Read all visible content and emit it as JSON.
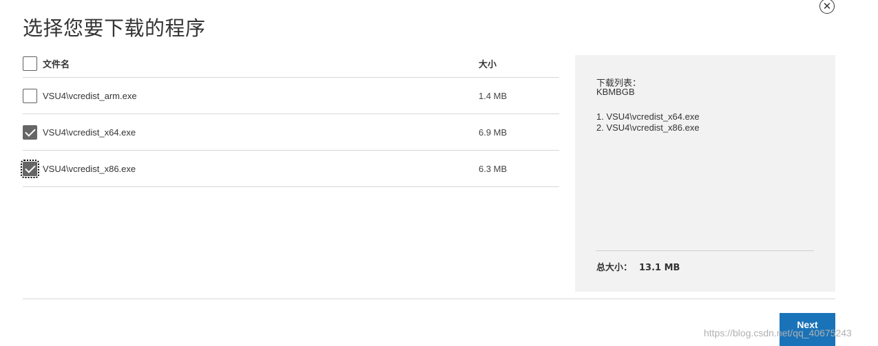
{
  "dialog": {
    "title": "选择您要下载的程序",
    "close_icon": "✕"
  },
  "table": {
    "headers": {
      "name": "文件名",
      "size": "大小"
    },
    "select_all_checked": false,
    "rows": [
      {
        "name": "VSU4\\vcredist_arm.exe",
        "size": "1.4 MB",
        "checked": false
      },
      {
        "name": "VSU4\\vcredist_x64.exe",
        "size": "6.9 MB",
        "checked": true
      },
      {
        "name": "VSU4\\vcredist_x86.exe",
        "size": "6.3 MB",
        "checked": true,
        "focused": true
      }
    ]
  },
  "panel": {
    "title": "下载列表：",
    "package_name": "KBMBGB",
    "items": [
      "1. VSU4\\vcredist_x64.exe",
      "2. VSU4\\vcredist_x86.exe"
    ],
    "total_label": "总大小：",
    "total_value": "13.1 MB"
  },
  "footer": {
    "next_label": "Next"
  },
  "watermark": "https://blog.csdn.net/qq_40675243",
  "colors": {
    "accent": "#1a73b8",
    "checked": "#666666",
    "panel_bg": "#f2f2f2"
  }
}
